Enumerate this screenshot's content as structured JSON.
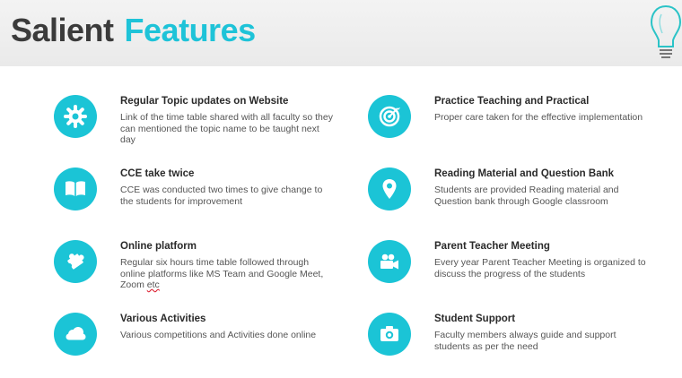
{
  "header": {
    "title_part1": "Salient",
    "title_part2": "Features"
  },
  "colors": {
    "accent": "#1bc4d6",
    "title_dark": "#3b3b3b",
    "title_accent": "#1ec3d8"
  },
  "left_features": [
    {
      "icon": "gear-icon",
      "title": "Regular Topic updates on Website",
      "description": "Link of the time table shared with all faculty so they can mentioned the topic name to be taught next day"
    },
    {
      "icon": "book-icon",
      "title": "CCE take twice",
      "description": "CCE was conducted two times to give change to the students for improvement"
    },
    {
      "icon": "puzzle-icon",
      "title": "Online platform",
      "description_main": "Regular six hours time table followed through online platforms like MS Team and Google Meet, Zoom ",
      "description_tail": "etc"
    },
    {
      "icon": "cloud-icon",
      "title": "Various Activities",
      "description": "Various competitions and Activities done online"
    }
  ],
  "right_features": [
    {
      "icon": "target-icon",
      "title": "Practice Teaching and Practical",
      "description": "Proper care taken for the effective implementation"
    },
    {
      "icon": "location-pin-icon",
      "title": "Reading Material and Question Bank",
      "description": "Students are provided Reading material and Question bank through Google classroom"
    },
    {
      "icon": "video-camera-icon",
      "title": "Parent Teacher Meeting",
      "description": "Every year Parent Teacher Meeting is organized to discuss the progress of the students"
    },
    {
      "icon": "camera-icon",
      "title": "Student Support",
      "description": "Faculty members always guide and support students as per the need"
    }
  ]
}
